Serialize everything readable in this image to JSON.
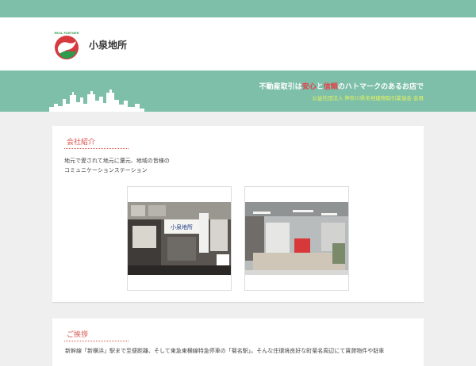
{
  "header": {
    "site_name": "小泉地所",
    "logo_text": "REAL PARTNER"
  },
  "banner": {
    "tagline_pre": "不動産取引は",
    "tagline_hl1": "安心",
    "tagline_mid": "と",
    "tagline_hl2": "信頼",
    "tagline_post": "のハトマークのあるお店で",
    "association": "公益社団法人 神奈川県宅地建物取引業協会 会員"
  },
  "company": {
    "title": "会社紹介",
    "lines": [
      "地元で愛されて地元に還元、地域の皆様の",
      "コミュニケーションステーション"
    ],
    "sign_text": "小泉地所"
  },
  "greeting": {
    "title": "ご挨拶",
    "text": "新幹線「新横浜」駅まで至便距離、そして東急東横線特急停車の「菊名駅」。そんな住環境良好な町菊名周辺にて賃貸物件や駐車"
  },
  "colors": {
    "accent": "#7dbfa9",
    "heading": "#d9534f",
    "highlight": "#e2434a",
    "association": "#e9f45c"
  }
}
